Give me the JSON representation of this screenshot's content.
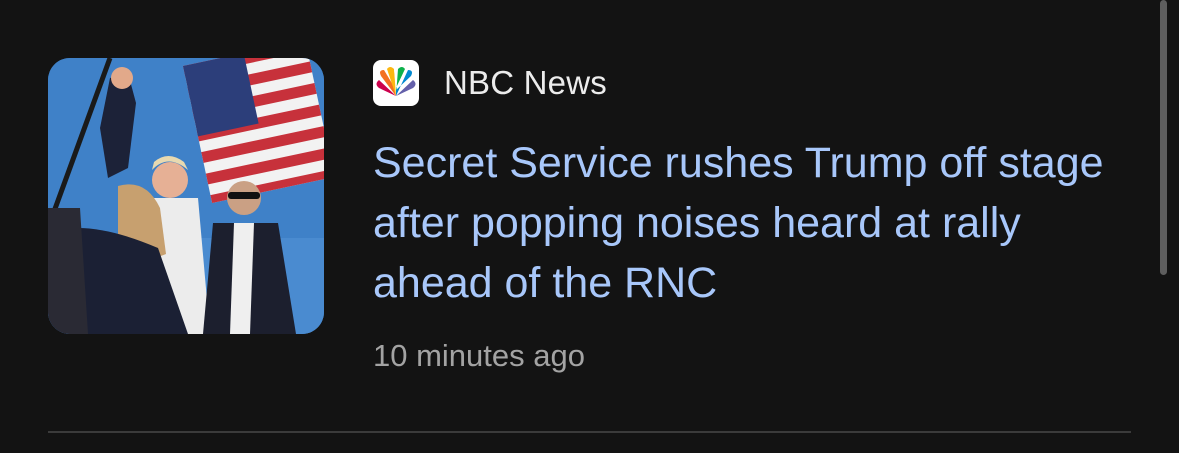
{
  "article": {
    "source": "NBC News",
    "source_logo_icon": "nbc-peacock-icon",
    "headline": "Secret Service rushes Trump off stage after popping noises heard at rally ahead of the RNC",
    "time": "10 minutes ago",
    "thumbnail_icon": "news-photo-thumbnail"
  },
  "colors": {
    "background": "#131313",
    "headline": "#a8c7fa",
    "source_text": "#ececec",
    "time_text": "#a3a3a3",
    "divider": "#3b3b3b"
  }
}
